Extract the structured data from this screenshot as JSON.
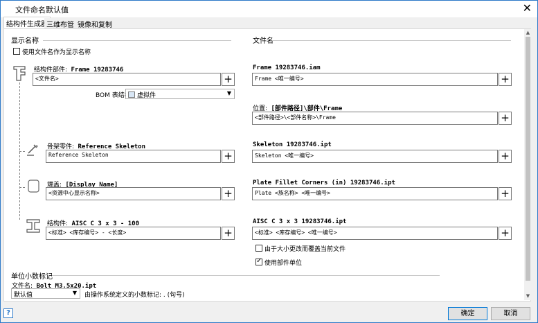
{
  "window": {
    "title": "文件命名默认值",
    "close_glyph": "✕"
  },
  "tabs": [
    {
      "label": "结构件生成器"
    },
    {
      "label": "三维布管"
    },
    {
      "label": "镜像和复制"
    }
  ],
  "left": {
    "section_title": "显示名称",
    "use_filename_checkbox": {
      "label": "使用文件名作为显示名称",
      "checked": false
    },
    "struct_part": {
      "label_cn": "结构件部件:",
      "label_val": "Frame 19283746",
      "input": "<文件名>"
    },
    "bom": {
      "label": "BOM 表结构",
      "value": "虚拟件"
    },
    "skeleton": {
      "label_cn": "骨架零件:",
      "label_val": "Reference Skeleton",
      "input": "Reference Skeleton"
    },
    "cap": {
      "label_cn": "端盖:",
      "label_val": "[Display Name]",
      "input": "<资源中心显示名称>"
    },
    "member": {
      "label_cn": "结构件:",
      "label_val": "AISC C 3 x 3 - 100",
      "input": "<标准> <库存编号> - <长度>"
    }
  },
  "right": {
    "section_title": "文件名",
    "frame": {
      "label": "Frame 19283746.iam",
      "input": "Frame <唯一编号>"
    },
    "location": {
      "label_cn": "位置:",
      "label_val": "[部件路径]\\部件\\Frame",
      "input": "<部件路径>\\<部件名称>\\Frame"
    },
    "skeleton": {
      "label": "Skeleton 19283746.ipt",
      "input": "Skeleton <唯一编号>"
    },
    "plate": {
      "label": "Plate Fillet Corners (in) 19283746.ipt",
      "input": "Plate <族名称> <唯一编号>"
    },
    "aisc": {
      "label": "AISC C 3 x 3 19283746.ipt",
      "input": "<标准> <库存编号> <唯一编号>"
    },
    "override_checkbox": {
      "label": "由于大小更改而覆盖当前文件",
      "checked": false
    },
    "units_checkbox": {
      "label": "使用部件单位",
      "checked": true
    }
  },
  "decimal": {
    "section_title": "单位小数标记",
    "filename_label_cn": "文件名:",
    "filename_label_val": "Bolt M3.5x20.ipt",
    "select_value": "默认值",
    "desc": "由操作系统定义的小数标记: . (句号)"
  },
  "buttons": {
    "plus": "+",
    "ok": "确定",
    "cancel": "取消",
    "help": "?"
  }
}
